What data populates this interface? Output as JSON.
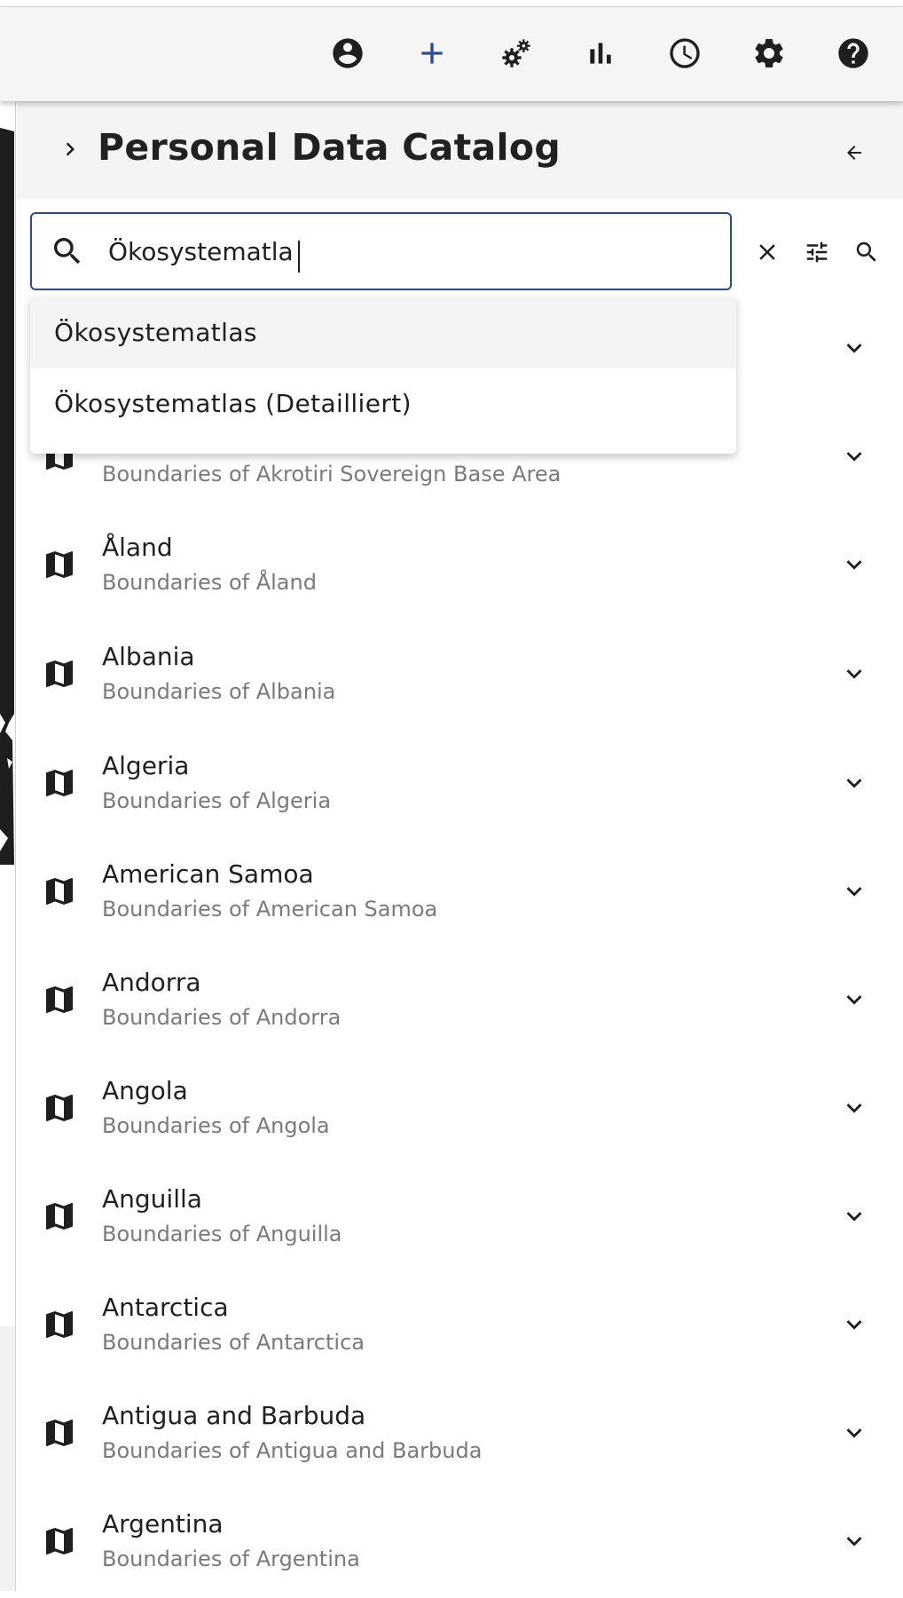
{
  "toolbar": {
    "icons": [
      "account-circle-icon",
      "plus-icon",
      "cogs-icon",
      "bar-chart-icon",
      "clock-icon",
      "settings-icon",
      "help-icon"
    ],
    "accent_color": "#2e4a8f"
  },
  "panel": {
    "title": "Personal Data Catalog"
  },
  "search": {
    "value": "Ökosystematla"
  },
  "suggestions": [
    {
      "label": "Ökosystematlas"
    },
    {
      "label": "Ökosystematlas (Detailliert)"
    }
  ],
  "catalog": {
    "items": [
      {
        "title": "",
        "subtitle": ""
      },
      {
        "title": "",
        "subtitle": "Boundaries of Akrotiri Sovereign Base Area"
      },
      {
        "title": "Åland",
        "subtitle": "Boundaries of Åland"
      },
      {
        "title": "Albania",
        "subtitle": "Boundaries of Albania"
      },
      {
        "title": "Algeria",
        "subtitle": "Boundaries of Algeria"
      },
      {
        "title": "American Samoa",
        "subtitle": "Boundaries of American Samoa"
      },
      {
        "title": "Andorra",
        "subtitle": "Boundaries of Andorra"
      },
      {
        "title": "Angola",
        "subtitle": "Boundaries of Angola"
      },
      {
        "title": "Anguilla",
        "subtitle": "Boundaries of Anguilla"
      },
      {
        "title": "Antarctica",
        "subtitle": "Boundaries of Antarctica"
      },
      {
        "title": "Antigua and Barbuda",
        "subtitle": "Boundaries of Antigua and Barbuda"
      },
      {
        "title": "Argentina",
        "subtitle": "Boundaries of Argentina"
      }
    ]
  }
}
